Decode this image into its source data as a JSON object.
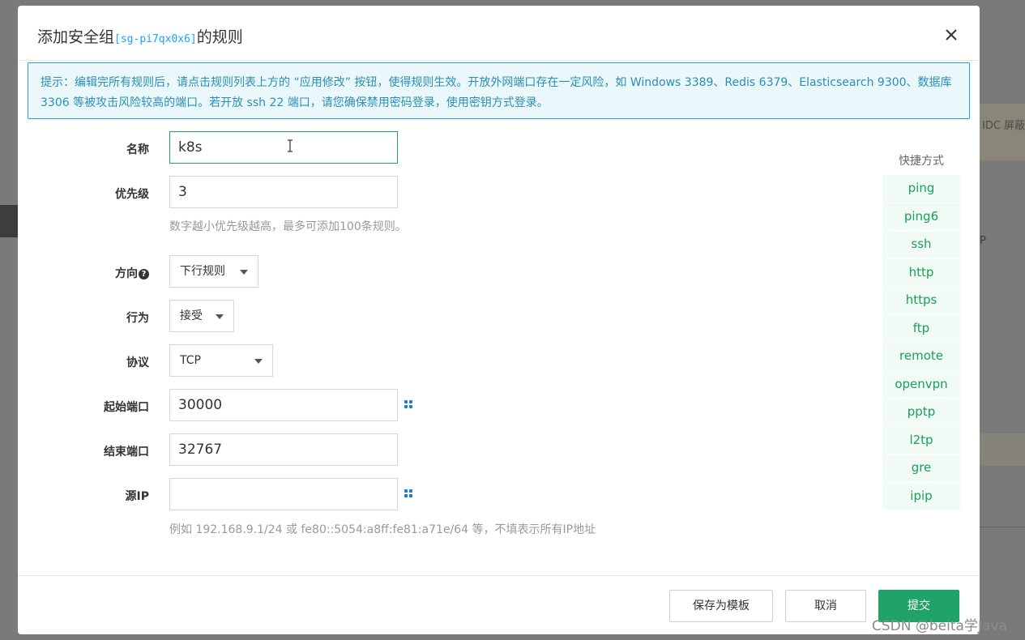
{
  "background": {
    "right_text": "IDC 屏蔽",
    "right_ip": "P"
  },
  "modal": {
    "title_prefix": "添加安全组",
    "group_id": "[sg-pi7qx0x6]",
    "title_suffix": "的规则",
    "notice": "提示：编辑完所有规则后，请点击规则列表上方的 “应用修改” 按钮，使得规则生效。开放外网端口存在一定风险，如 Windows 3389、Redis 6379、Elasticsearch 9300、数据库 3306 等被攻击风险较高的端口。若开放 ssh 22 端口，请您确保禁用密码登录，使用密钥方式登录。"
  },
  "form": {
    "name": {
      "label": "名称",
      "value": "k8s"
    },
    "priority": {
      "label": "优先级",
      "value": "3",
      "hint": "数字越小优先级越高，最多可添加100条规则。"
    },
    "direction": {
      "label": "方向",
      "value": "下行规则"
    },
    "action": {
      "label": "行为",
      "value": "接受"
    },
    "protocol": {
      "label": "协议",
      "value": "TCP"
    },
    "start_port": {
      "label": "起始端口",
      "value": "30000"
    },
    "end_port": {
      "label": "结束端口",
      "value": "32767"
    },
    "source_ip": {
      "label": "源IP",
      "value": "",
      "hint": "例如 192.168.9.1/24 或 fe80::5054:a8ff:fe81:a71e/64 等，不填表示所有IP地址"
    }
  },
  "shortcuts": {
    "title": "快捷方式",
    "items": [
      "ping",
      "ping6",
      "ssh",
      "http",
      "https",
      "ftp",
      "remote",
      "openvpn",
      "pptp",
      "l2tp",
      "gre",
      "ipip"
    ]
  },
  "footer": {
    "save_template": "保存为模板",
    "cancel": "取消",
    "submit": "提交"
  },
  "watermark": "CSDN @beita学Java",
  "colors": {
    "accent": "#20a366",
    "notice_border": "#29a3c7",
    "notice_text": "#2a8fb8",
    "shortcut_text": "#1aa05a"
  }
}
